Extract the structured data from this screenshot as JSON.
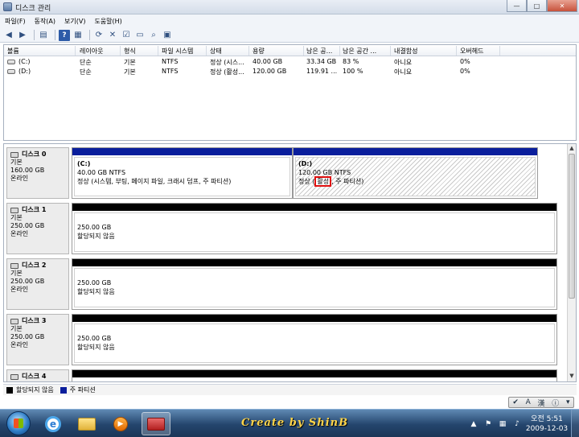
{
  "window": {
    "title": "디스크 관리",
    "controls": {
      "minimize": "—",
      "maximize": "□",
      "close": "✕"
    }
  },
  "menu": [
    "파일(F)",
    "동작(A)",
    "보기(V)",
    "도움말(H)"
  ],
  "toolbar": {
    "icons": [
      "back-arrow-icon",
      "forward-arrow-icon",
      "show-hide-tree-icon",
      "help-icon",
      "refresh-icon",
      "delete-icon",
      "properties-icon",
      "open-folder-icon",
      "search-icon",
      "view-icon"
    ],
    "help_label": "?"
  },
  "volume_list": {
    "columns": [
      "볼륨",
      "레이아웃",
      "형식",
      "파일 시스템",
      "상태",
      "용량",
      "남은 공...",
      "남은 공간 ...",
      "내결함성",
      "오버헤드"
    ],
    "rows": [
      {
        "volume": "(C:)",
        "layout": "단순",
        "type": "기본",
        "fs": "NTFS",
        "status": "정상 (시스...",
        "capacity": "40.00 GB",
        "free": "33.34 GB",
        "free_pct": "83 %",
        "fault": "아니요",
        "overhead": "0%"
      },
      {
        "volume": "(D:)",
        "layout": "단순",
        "type": "기본",
        "fs": "NTFS",
        "status": "정상 (활성...",
        "capacity": "120.00 GB",
        "free": "119.91 ...",
        "free_pct": "100 %",
        "fault": "아니요",
        "overhead": "0%"
      }
    ]
  },
  "disks": [
    {
      "name": "디스크 0",
      "type": "기본",
      "size": "160.00 GB",
      "state": "온라인",
      "partitions": [
        {
          "label": "(C:)",
          "size": "40.00 GB NTFS",
          "status": "정상 (시스템, 부팅, 페이지 파일, 크래시 덤프, 주 파티션)"
        },
        {
          "label": "(D:)",
          "size": "120.00 GB NTFS",
          "status_pre": "정상 (",
          "status_highlight": "활성",
          "status_post": ", 주 파티션)"
        }
      ]
    },
    {
      "name": "디스크 1",
      "type": "기본",
      "size": "250.00 GB",
      "state": "온라인",
      "partitions": [
        {
          "size": "250.00 GB",
          "status": "할당되지 않음"
        }
      ]
    },
    {
      "name": "디스크 2",
      "type": "기본",
      "size": "250.00 GB",
      "state": "온라인",
      "partitions": [
        {
          "size": "250.00 GB",
          "status": "할당되지 않음"
        }
      ]
    },
    {
      "name": "디스크 3",
      "type": "기본",
      "size": "250.00 GB",
      "state": "온라인",
      "partitions": [
        {
          "size": "250.00 GB",
          "status": "할당되지 않음"
        }
      ]
    },
    {
      "name": "디스크 4"
    }
  ],
  "legend": [
    {
      "label": "할당되지 않음",
      "color": "#000000"
    },
    {
      "label": "주 파티션",
      "color": "#0a1e9c"
    }
  ],
  "taskbar": {
    "watermark": "Create by ShinB",
    "clock_time": "오전 5:51",
    "clock_date": "2009-12-03"
  },
  "ime": {
    "mode": "A",
    "hanja": "漢"
  }
}
